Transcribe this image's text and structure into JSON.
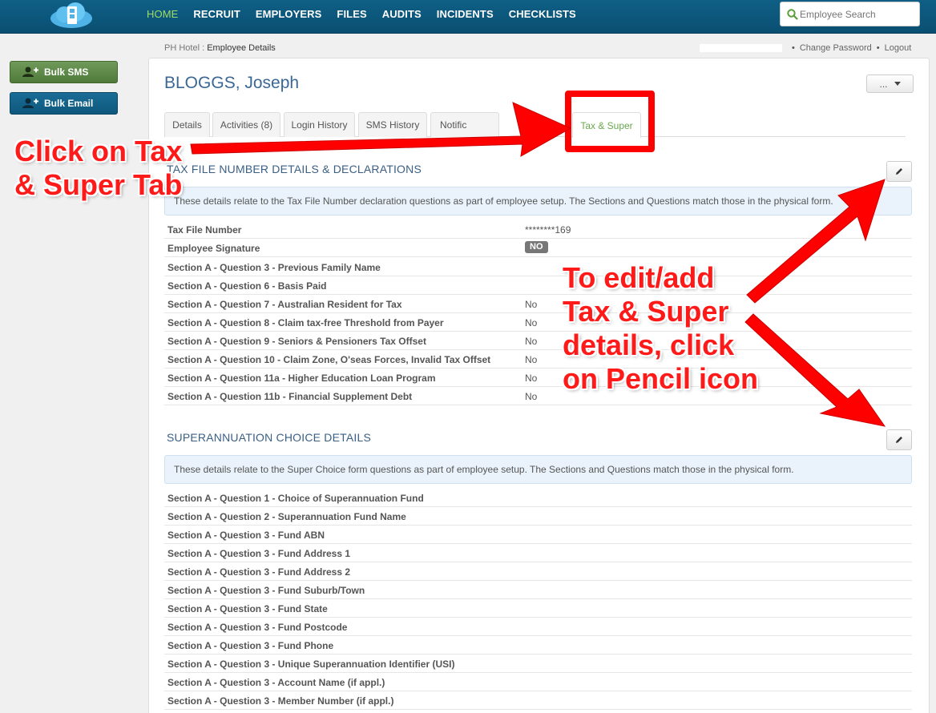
{
  "nav": {
    "items": [
      "HOME",
      "RECRUIT",
      "EMPLOYERS",
      "FILES",
      "AUDITS",
      "INCIDENTS",
      "CHECKLISTS"
    ],
    "active": "HOME",
    "search_placeholder": "Employee Search"
  },
  "sidebar": {
    "bulk_sms": "Bulk SMS",
    "bulk_email": "Bulk Email"
  },
  "breadcrumb": {
    "parent": "PH Hotel",
    "sep": " : ",
    "current": "Employee Details"
  },
  "toplinks": {
    "change_password": "Change Password",
    "logout": "Logout"
  },
  "employee": {
    "name": "BLOGGS, Joseph",
    "more_label": "..."
  },
  "tabs": {
    "details": "Details",
    "activities": "Activities (8)",
    "login_history": "Login History",
    "sms_history": "SMS History",
    "notifications": "Notific",
    "tax_super": "Tax & Super"
  },
  "tfn": {
    "title": "TAX FILE NUMBER DETAILS & DECLARATIONS",
    "info": "These details relate to the Tax File Number declaration questions as part of employee setup. The Sections and Questions match those in the physical form.",
    "rows": [
      {
        "label": "Tax File Number",
        "value": "********169"
      },
      {
        "label": "Employee Signature",
        "value": "NO"
      },
      {
        "label": "Section A - Question 3 - Previous Family Name",
        "value": ""
      },
      {
        "label": "Section A - Question 6 - Basis Paid",
        "value": ""
      },
      {
        "label": "Section A - Question 7 - Australian Resident for Tax",
        "value": "No"
      },
      {
        "label": "Section A - Question 8 - Claim tax-free Threshold from Payer",
        "value": "No"
      },
      {
        "label": "Section A - Question 9 - Seniors & Pensioners Tax Offset",
        "value": "No"
      },
      {
        "label": "Section A - Question 10 - Claim Zone, O'seas Forces, Invalid Tax Offset",
        "value": "No"
      },
      {
        "label": "Section A - Question 11a - Higher Education Loan Program",
        "value": "No"
      },
      {
        "label": "Section A - Question 11b - Financial Supplement Debt",
        "value": "No"
      }
    ]
  },
  "super": {
    "title": "SUPERANNUATION CHOICE DETAILS",
    "info": "These details relate to the Super Choice form questions as part of employee setup. The Sections and Questions match those in the physical form.",
    "rows": [
      {
        "label": "Section A - Question 1 - Choice of Superannuation Fund"
      },
      {
        "label": "Section A - Question 2 - Superannuation Fund Name"
      },
      {
        "label": "Section A - Question 3 - Fund ABN"
      },
      {
        "label": "Section A - Question 3 - Fund Address 1"
      },
      {
        "label": "Section A - Question 3 - Fund Address 2"
      },
      {
        "label": "Section A - Question 3 - Fund Suburb/Town"
      },
      {
        "label": "Section A - Question 3 - Fund State"
      },
      {
        "label": "Section A - Question 3 - Fund Postcode"
      },
      {
        "label": "Section A - Question 3 - Fund Phone"
      },
      {
        "label": "Section A - Question 3 - Unique Superannuation Identifier (USI)"
      },
      {
        "label": "Section A - Question 3 - Account Name (if appl.)"
      },
      {
        "label": "Section A - Question 3 - Member Number (if appl.)"
      }
    ]
  },
  "annotations": {
    "left_line1": "Click on Tax",
    "left_line2": "& Super Tab",
    "right_line1": "To edit/add",
    "right_line2": "Tax & Super",
    "right_line3": "details, click",
    "right_line4": "on Pencil icon"
  },
  "icons": {
    "logo": "cloud-logo-icon",
    "search": "search-icon",
    "user_add": "user-add-icon",
    "pencil": "pencil-icon",
    "caret": "caret-down-icon"
  },
  "colors": {
    "nav_bg": "#0f5f86",
    "nav_active": "#9fdc6a",
    "sms_btn": "#5f8a49",
    "email_btn": "#146289",
    "title_blue": "#3a6795",
    "annotation_red": "#ff1a1a"
  }
}
